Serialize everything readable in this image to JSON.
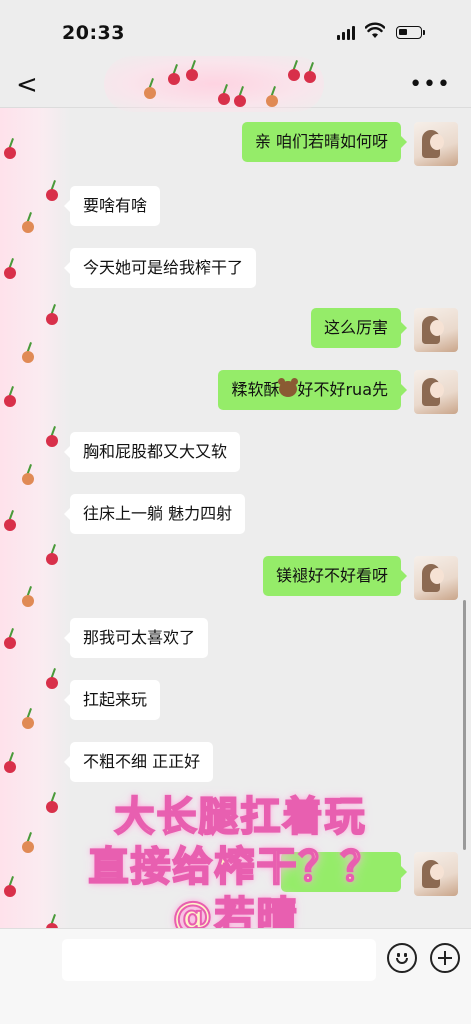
{
  "status_bar": {
    "time": "20:33"
  },
  "nav": {
    "back_glyph": "<",
    "more_glyph": "•••",
    "title": ""
  },
  "messages": [
    {
      "side": "right",
      "text": "亲 咱们若晴如何呀"
    },
    {
      "side": "left",
      "text": "要啥有啥"
    },
    {
      "side": "left",
      "text": "今天她可是给我榨干了"
    },
    {
      "side": "right",
      "text": "这么厉害"
    },
    {
      "side": "right",
      "text_before": "糅软酥",
      "emoji": "bear-emoji",
      "text_after": "好不好rua先"
    },
    {
      "side": "left",
      "text": "胸和屁股都又大又软"
    },
    {
      "side": "left",
      "text": "往床上一躺 魅力四射"
    },
    {
      "side": "right",
      "text": "镁褪好不好看呀"
    },
    {
      "side": "left",
      "text": "那我可太喜欢了"
    },
    {
      "side": "left",
      "text": "扛起来玩"
    },
    {
      "side": "left",
      "text": "不粗不细 正正好"
    },
    {
      "side": "right",
      "text": ""
    }
  ],
  "overlay": {
    "line1": "大长腿扛着玩",
    "line2": "直接给榨干？？",
    "line3": "@若晴"
  },
  "bottom": {
    "input_value": "",
    "emoji_icon": "smile-icon",
    "plus_icon": "plus-icon"
  },
  "colors": {
    "sent_bubble": "#95ec69",
    "received_bubble": "#ffffff",
    "background": "#ededed",
    "overlay_text": "#fff4c8",
    "overlay_stroke": "#e85fb0"
  }
}
